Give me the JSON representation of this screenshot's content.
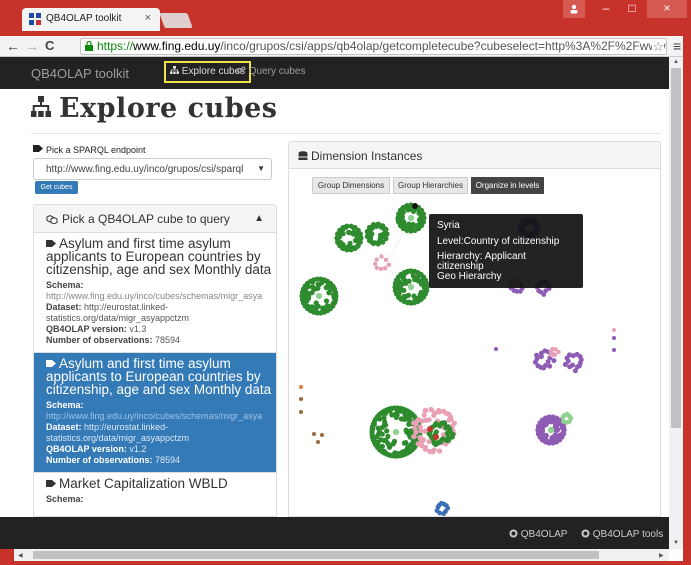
{
  "browser": {
    "tab_title": "QB4OLAP toolkit",
    "tab_close": "×",
    "url_scheme": "https://",
    "url_host": "www.fing.edu.uy",
    "url_path": "/inco/grupos/csi/apps/qb4olap/getcompletecube?cubeselect=http%3A%2F%2Fwww.fing.e",
    "back": "←",
    "forward": "→",
    "reload": "C",
    "star": "☆",
    "menu": "≡",
    "win_min": "–",
    "win_max": "□",
    "win_close": "×",
    "accent_color": "#c7332b"
  },
  "navbar": {
    "brand": "QB4OLAP toolkit",
    "explore_label": "Explore cubes",
    "query_label": "Query cubes"
  },
  "page": {
    "title": "Explore cubes"
  },
  "endpoint": {
    "label": "Pick a SPARQL endpoint",
    "selected": "http://www.fing.edu.uy/inco/grupos/csi/sparql",
    "get_cubes_label": "Get cubes"
  },
  "cubes_panel": {
    "header": "Pick a QB4OLAP cube to query",
    "items": [
      {
        "title": "Asylum and first time asylum applicants to European countries by citizenship, age and sex Monthly data",
        "schema_key": "Schema:",
        "schema": "http://www.fing.edu.uy/inco/cubes/schemas/migr_asya",
        "dataset_key": "Dataset:",
        "dataset_1": "http://eurostat.linked-",
        "dataset_2": "statistics.org/data/migr_asyappctzm",
        "version_key": "QB4OLAP version:",
        "version": "v1.3",
        "obs_key": "Number of observations:",
        "obs": "78594"
      },
      {
        "title": "Asylum and first time asylum applicants to European countries by citizenship, age and sex Monthly data",
        "schema_key": "Schema:",
        "schema": "http://www.fing.edu.uy/inco/cubes/schemas/migr_asya",
        "dataset_key": "Dataset:",
        "dataset_1": "http://eurostat.linked-",
        "dataset_2": "statistics.org/data/migr_asyappctzm",
        "version_key": "QB4OLAP version:",
        "version": "v1.2",
        "obs_key": "Number of observations:",
        "obs": "78594"
      },
      {
        "title": "Market Capitalization WBLD",
        "schema_key": "Schema:"
      }
    ]
  },
  "dimension_panel": {
    "header": "Dimension Instances",
    "buttons": [
      "Group Dimensions",
      "Group Hierarchies",
      "Organize in levels"
    ],
    "active_button": "Organize in levels",
    "colors": {
      "green": "#2e8b2e",
      "light_green": "#8fd18f",
      "purple": "#8e5bb5",
      "pink": "#e8a0b4",
      "red": "#c0392b",
      "blue": "#3b6fb6",
      "brown": "#9a6a3a",
      "orange": "#e07b39"
    }
  },
  "tooltip": {
    "name": "Syria",
    "level": "Level:Country of citizenship",
    "hierarchy_1": "Hierarchy: Applicant citizenship",
    "hierarchy_2": "Geo Hierarchy"
  },
  "footer": {
    "link1": "QB4OLAP",
    "link2": "QB4OLAP tools"
  }
}
